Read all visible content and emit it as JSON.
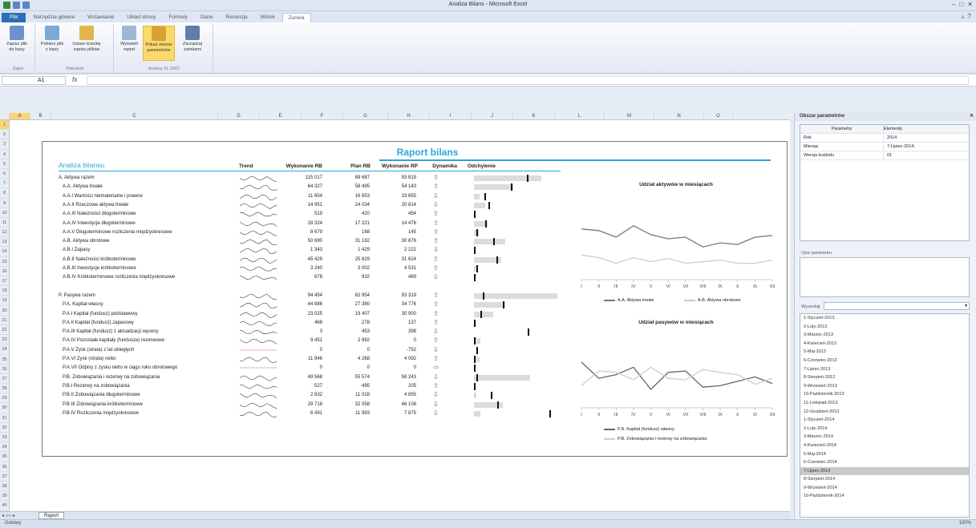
{
  "window_title": "Analiza Bilans - Microsoft Excel",
  "ribbon_tabs": [
    {
      "label": "Plik"
    },
    {
      "label": "Narzędzia główne"
    },
    {
      "label": "Wstawianie"
    },
    {
      "label": "Układ strony"
    },
    {
      "label": "Formuły"
    },
    {
      "label": "Dane"
    },
    {
      "label": "Recenzja"
    },
    {
      "label": "Widok"
    },
    {
      "label": "Zuneia"
    }
  ],
  "ribbon": {
    "groups": [
      {
        "label": "Zapis"
      },
      {
        "label": "Pobranie"
      },
      {
        "label": "Analizy XL 2007"
      }
    ],
    "buttons": [
      {
        "label": "Zapisz plik do bazy"
      },
      {
        "label": "Pobierz plik z bazy"
      },
      {
        "label": "Ustaw ścieżkę zapisu plików"
      },
      {
        "label": "Wyświetl raport"
      },
      {
        "label": "Pokaż obszar parametrów"
      },
      {
        "label": "Zarządzaj zamkami"
      }
    ]
  },
  "formula_bar": {
    "cell": "A1",
    "fx": "fx",
    "value": ""
  },
  "columns": [
    "A",
    "B",
    "C",
    "D",
    "E",
    "F",
    "G",
    "H",
    "I",
    "J",
    "K",
    "L",
    "M",
    "N",
    "O"
  ],
  "report": {
    "title": "Raport bilans",
    "section_title": "Analiza bilansu",
    "headers": {
      "trend": "Trend",
      "plan_wyk": "Wykonanie RB",
      "plan": "Plan RB",
      "wyk_rp": "Wykonanie RP",
      "dyn": "Dynamika",
      "odch": "Odchylenie"
    },
    "rows": [
      {
        "label": "A. Aktywa razem",
        "v1": "115 017",
        "v2": "89 687",
        "v3": "93 819",
        "dyn": "up",
        "bar": 0.6,
        "tick": 0.47
      },
      {
        "label": "A.A. Aktywa trwałe",
        "v1": "64 327",
        "v2": "58 495",
        "v3": "54 143",
        "dyn": "up",
        "bar": 0.35,
        "tick": 0.33
      },
      {
        "label": "A.A.I Wartości niematerialne i prawne",
        "v1": "11 654",
        "v2": "16 653",
        "v3": "19 655",
        "dyn": "down",
        "bar": 0.05,
        "tick": 0.09
      },
      {
        "label": "A.A.II Rzeczowe aktywa trwałe",
        "v1": "14 951",
        "v2": "24 034",
        "v3": "20 814",
        "dyn": "down",
        "bar": 0.1,
        "tick": 0.13
      },
      {
        "label": "A.A.III Należności długoterminowe",
        "v1": "519",
        "v2": "420",
        "v3": "454",
        "dyn": "up",
        "bar": 0.0,
        "tick": 0.0
      },
      {
        "label": "A.A.IV Inwestycje długoterminowe",
        "v1": "28 324",
        "v2": "17 221",
        "v3": "14 476",
        "dyn": "up",
        "bar": 0.12,
        "tick": 0.1
      },
      {
        "label": "A.A.V Długoterminowe rozliczenia międzyokresowe",
        "v1": "8 679",
        "v2": "168",
        "v3": "145",
        "dyn": "up",
        "bar": 0.04,
        "tick": 0.02
      },
      {
        "label": "A.B. Aktywa obrotowe",
        "v1": "50 690",
        "v2": "31 192",
        "v3": "30 876",
        "dyn": "up",
        "bar": 0.28,
        "tick": 0.17
      },
      {
        "label": "A.B.I Zapasy",
        "v1": "1 343",
        "v2": "1 429",
        "v3": "2 222",
        "dyn": "down",
        "bar": 0.0,
        "tick": 0.0
      },
      {
        "label": "A.B.II Należności krótkoterminowe",
        "v1": "45 429",
        "v2": "25 829",
        "v3": "31 624",
        "dyn": "up",
        "bar": 0.24,
        "tick": 0.2
      },
      {
        "label": "A.B.III Inwestycje krótkoterminowe",
        "v1": "3 240",
        "v2": "3 002",
        "v3": "4 531",
        "dyn": "up",
        "bar": 0.03,
        "tick": 0.02
      },
      {
        "label": "A.B.IV Krótkoterminowe rozliczenia międzyokresowe",
        "v1": "678",
        "v2": "932",
        "v3": "489",
        "dyn": "down",
        "bar": 0.0,
        "tick": 0.0
      },
      {
        "label": "",
        "v1": "",
        "v2": "",
        "v3": "",
        "dyn": "",
        "bar": 0,
        "tick": -1
      },
      {
        "label": "P. Pasywa razem",
        "v1": "94 454",
        "v2": "82 954",
        "v3": "93 319",
        "dyn": "up",
        "bar": 0.74,
        "tick": 0.08
      },
      {
        "label": "P.A. Kapitał własny",
        "v1": "44 886",
        "v2": "27 380",
        "v3": "34 776",
        "dyn": "up",
        "bar": 0.28,
        "tick": 0.26
      },
      {
        "label": "P.A.I Kapitał (fundusz) podstawowy",
        "v1": "23 025",
        "v2": "19 407",
        "v3": "30 900",
        "dyn": "up",
        "bar": 0.17,
        "tick": 0.06
      },
      {
        "label": "P.A.II Kapitał (fundusz) zapasowy",
        "v1": "468",
        "v2": "278",
        "v3": "137",
        "dyn": "up",
        "bar": 0.0,
        "tick": 0.0
      },
      {
        "label": "P.A.III Kapitał (fundusz) z aktualizacji wyceny",
        "v1": "3",
        "v2": "453",
        "v3": "398",
        "dyn": "down",
        "bar": 0.0,
        "tick": 0.48
      },
      {
        "label": "P.A.IV Pozostałe kapitały (fundusze) rezerwowe",
        "v1": "9 451",
        "v2": "2 982",
        "v3": "0",
        "dyn": "up",
        "bar": 0.06,
        "tick": 0.0
      },
      {
        "label": "P.A.V Zysk (strata) z lat ubiegłych",
        "v1": "0",
        "v2": "0",
        "v3": "-752",
        "dyn": "down",
        "bar": 0.0,
        "tick": 0.02
      },
      {
        "label": "P.A.VI Zysk (strata) netto",
        "v1": "11 946",
        "v2": "4 268",
        "v3": "4 092",
        "dyn": "up",
        "bar": 0.05,
        "tick": 0.0
      },
      {
        "label": "P.A.VII Odpisy z zysku netto w ciągu roku obrotowego",
        "v1": "0",
        "v2": "0",
        "v3": "0",
        "dyn": "right",
        "bar": 0.0,
        "tick": 0.0
      },
      {
        "label": "P.B. Zobowiązania i rezerwy na zobowiązania",
        "v1": "49 568",
        "v2": "55 574",
        "v3": "58 243",
        "dyn": "down",
        "bar": 0.5,
        "tick": 0.02
      },
      {
        "label": "P.B.I Rezerwy na zobowiązania",
        "v1": "527",
        "v2": "495",
        "v3": "205",
        "dyn": "up",
        "bar": 0.0,
        "tick": 0.0
      },
      {
        "label": "P.B.II Zobowiązania długoterminowe",
        "v1": "2 832",
        "v2": "11 028",
        "v3": "4 855",
        "dyn": "down",
        "bar": 0.02,
        "tick": 0.15
      },
      {
        "label": "P.B.III Zobowiązania krótkoterminowe",
        "v1": "29 718",
        "v2": "32 058",
        "v3": "46 108",
        "dyn": "down",
        "bar": 0.26,
        "tick": 0.21
      },
      {
        "label": "P.B.IV Rozliczenia międzyokresowe",
        "v1": "6 491",
        "v2": "11 993",
        "v3": "7 875",
        "dyn": "down",
        "bar": 0.06,
        "tick": 0.67
      }
    ]
  },
  "chart_data": [
    {
      "type": "line",
      "title": "Udział aktywów w miesiącach",
      "categories": [
        "I",
        "II",
        "III",
        "IV",
        "V",
        "VI",
        "VII",
        "VIII",
        "IX",
        "X",
        "XI",
        "XII"
      ],
      "series": [
        {
          "name": "A.A. Aktywa trwałe",
          "color": "#777777",
          "values": [
            0.62,
            0.6,
            0.52,
            0.66,
            0.55,
            0.5,
            0.52,
            0.4,
            0.45,
            0.43,
            0.52,
            0.54
          ]
        },
        {
          "name": "A.B. Aktywa obrotowe",
          "color": "#cccccc",
          "values": [
            0.3,
            0.27,
            0.2,
            0.27,
            0.22,
            0.26,
            0.2,
            0.22,
            0.24,
            0.2,
            0.2,
            0.24
          ]
        }
      ]
    },
    {
      "type": "line",
      "title": "Udział pasywów w miesiącach",
      "categories": [
        "I",
        "II",
        "III",
        "IV",
        "V",
        "VI",
        "VII",
        "VIII",
        "IX",
        "X",
        "XI",
        "XII"
      ],
      "series": [
        {
          "name": "P.A. Kapitał (fundusz) własny",
          "color": "#666666",
          "values": [
            0.62,
            0.4,
            0.45,
            0.55,
            0.25,
            0.48,
            0.5,
            0.28,
            0.3,
            0.36,
            0.42,
            0.33
          ]
        },
        {
          "name": "P.B. Zobowiązania i rezerwy na zobowiązania",
          "color": "#cccccc",
          "values": [
            0.3,
            0.5,
            0.48,
            0.38,
            0.55,
            0.4,
            0.38,
            0.52,
            0.48,
            0.45,
            0.32,
            0.4
          ]
        }
      ]
    }
  ],
  "sheet_tabs": [
    {
      "label": "Raport"
    }
  ],
  "status": {
    "left": "Gotowy",
    "zoom": "100%"
  },
  "pane": {
    "title": "Obszar parametrów",
    "table_headers": [
      "Parametry",
      "Elementy"
    ],
    "params": [
      {
        "k": "Rok",
        "v": "2014"
      },
      {
        "k": "Miesiąc",
        "v": "7-Lipiec-2014;"
      },
      {
        "k": "Wersja budżetu",
        "v": "01"
      }
    ],
    "opis_label": "Opis parametru",
    "wyb_label": "Wyszukaj",
    "list": [
      "1-Styczeń-2013",
      "2-Luty-2013",
      "3-Marzec-2013",
      "4-Kwiecień-2013",
      "5-Maj-2013",
      "6-Czerwiec-2013",
      "7-Lipiec-2013",
      "8-Sierpień-2013",
      "9-Wrzesień-2013",
      "10-Październik-2013",
      "11-Listopad-2013",
      "12-Grudzień-2013",
      "1-Styczeń-2014",
      "2-Luty-2014",
      "3-Marzec-2014",
      "4-Kwiecień-2014",
      "5-Maj-2014",
      "6-Czerwiec-2014",
      "7-Lipiec-2014",
      "8-Sierpień-2014",
      "9-Wrzesień-2014",
      "10-Październik-2014"
    ],
    "selected_index": 18
  }
}
